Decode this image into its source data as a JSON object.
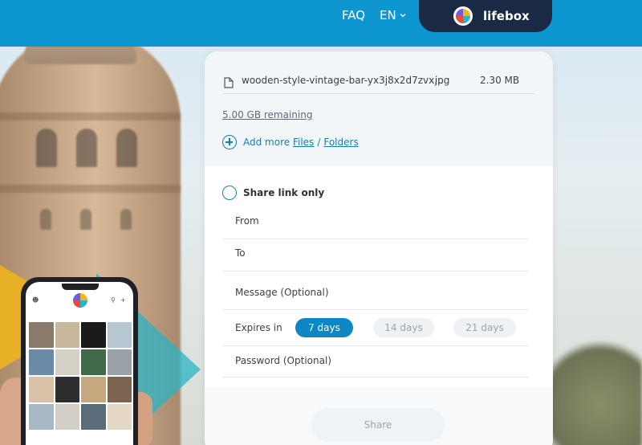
{
  "header": {
    "faq_label": "FAQ",
    "language_label": "EN",
    "brand_name": "lifebox"
  },
  "upload": {
    "file": {
      "name": "wooden-style-vintage-bar-yx3j8x2d7zvx...",
      "extension": ".jpg",
      "size": "2.30 MB"
    },
    "remaining": "5.00 GB remaining",
    "add_more_label": "Add more",
    "files_link": "Files",
    "separator": "/",
    "folders_link": "Folders"
  },
  "share_form": {
    "share_link_only_label": "Share link only",
    "from_label": "From",
    "to_label": "To",
    "message_label": "Message (Optional)",
    "expires_label": "Expires in",
    "expire_options": [
      {
        "label": "7 days",
        "selected": true
      },
      {
        "label": "14 days",
        "selected": false
      },
      {
        "label": "21 days",
        "selected": false
      }
    ],
    "password_label": "Password (Optional)",
    "share_button_label": "Share"
  },
  "colors": {
    "header_bg": "#0d96cf",
    "brand_bg": "#1a2a45",
    "accent": "#0d86c2",
    "link": "#167fa7"
  },
  "icons": {
    "file": "file-icon",
    "add": "plus-circle-icon",
    "chevron": "chevron-down-icon",
    "brand": "lifebox-logo-icon",
    "radio": "radio-unchecked-icon"
  }
}
